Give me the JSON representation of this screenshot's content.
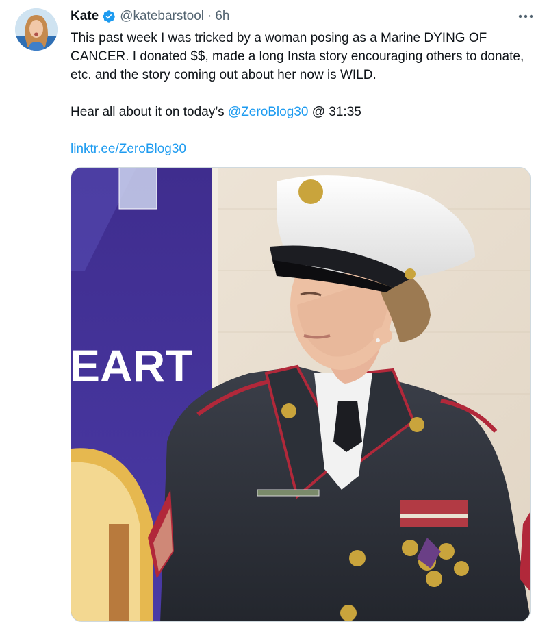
{
  "tweet": {
    "author_name": "Kate",
    "handle": "@katebarstool",
    "separator": "·",
    "time": "6h",
    "avatar_icon": "profile-avatar",
    "verified_icon": "verified-badge-icon",
    "more_icon": "more-horizontal-icon",
    "body_line1": "This past week I was tricked by a woman posing as a Marine DYING OF CANCER. I donated $$, made a long Insta story encouraging others to donate, etc. and the story coming out about her now is WILD.",
    "body_line2_prefix": "Hear all about it on today’s ",
    "body_line2_mention": "@ZeroBlog30",
    "body_line2_suffix": " @ 31:35",
    "link_text": "linktr.ee/ZeroBlog30",
    "media_sign_text": "EART"
  },
  "colors": {
    "link": "#1d9bf0",
    "verified": "#1d9bf0",
    "secondary_text": "#536471",
    "border": "#cfd9de"
  }
}
